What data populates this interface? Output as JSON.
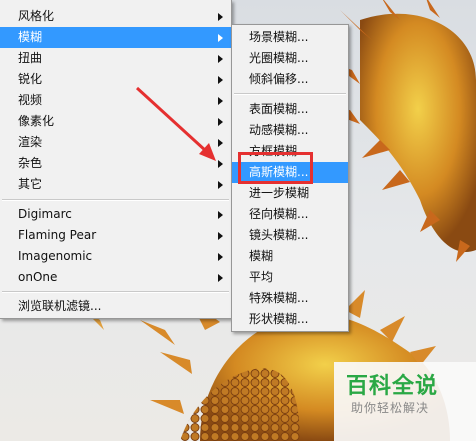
{
  "main_menu": {
    "items": [
      {
        "label": "风格化",
        "submenu": true
      },
      {
        "label": "模糊",
        "submenu": true,
        "highlighted": true
      },
      {
        "label": "扭曲",
        "submenu": true
      },
      {
        "label": "锐化",
        "submenu": true
      },
      {
        "label": "视频",
        "submenu": true
      },
      {
        "label": "像素化",
        "submenu": true
      },
      {
        "label": "渲染",
        "submenu": true
      },
      {
        "label": "杂色",
        "submenu": true
      },
      {
        "label": "其它",
        "submenu": true
      },
      {
        "label": "Digimarc",
        "submenu": true
      },
      {
        "label": "Flaming Pear",
        "submenu": true
      },
      {
        "label": "Imagenomic",
        "submenu": true
      },
      {
        "label": "onOne",
        "submenu": true
      },
      {
        "label": "浏览联机滤镜..."
      }
    ]
  },
  "blur_submenu": {
    "items": [
      {
        "label": "场景模糊..."
      },
      {
        "label": "光圈模糊..."
      },
      {
        "label": "倾斜偏移..."
      },
      {
        "label": "表面模糊..."
      },
      {
        "label": "动感模糊..."
      },
      {
        "label": "方框模糊..."
      },
      {
        "label": "高斯模糊...",
        "highlighted": true
      },
      {
        "label": "进一步模糊"
      },
      {
        "label": "径向模糊..."
      },
      {
        "label": "镜头模糊..."
      },
      {
        "label": "模糊"
      },
      {
        "label": "平均"
      },
      {
        "label": "特殊模糊..."
      },
      {
        "label": "形状模糊..."
      }
    ]
  },
  "watermark": {
    "title": "百科全说",
    "subtitle": "助你轻松解决"
  },
  "colors": {
    "highlight": "#3399ff",
    "annotation": "#e53030",
    "watermark": "#2aa845"
  }
}
